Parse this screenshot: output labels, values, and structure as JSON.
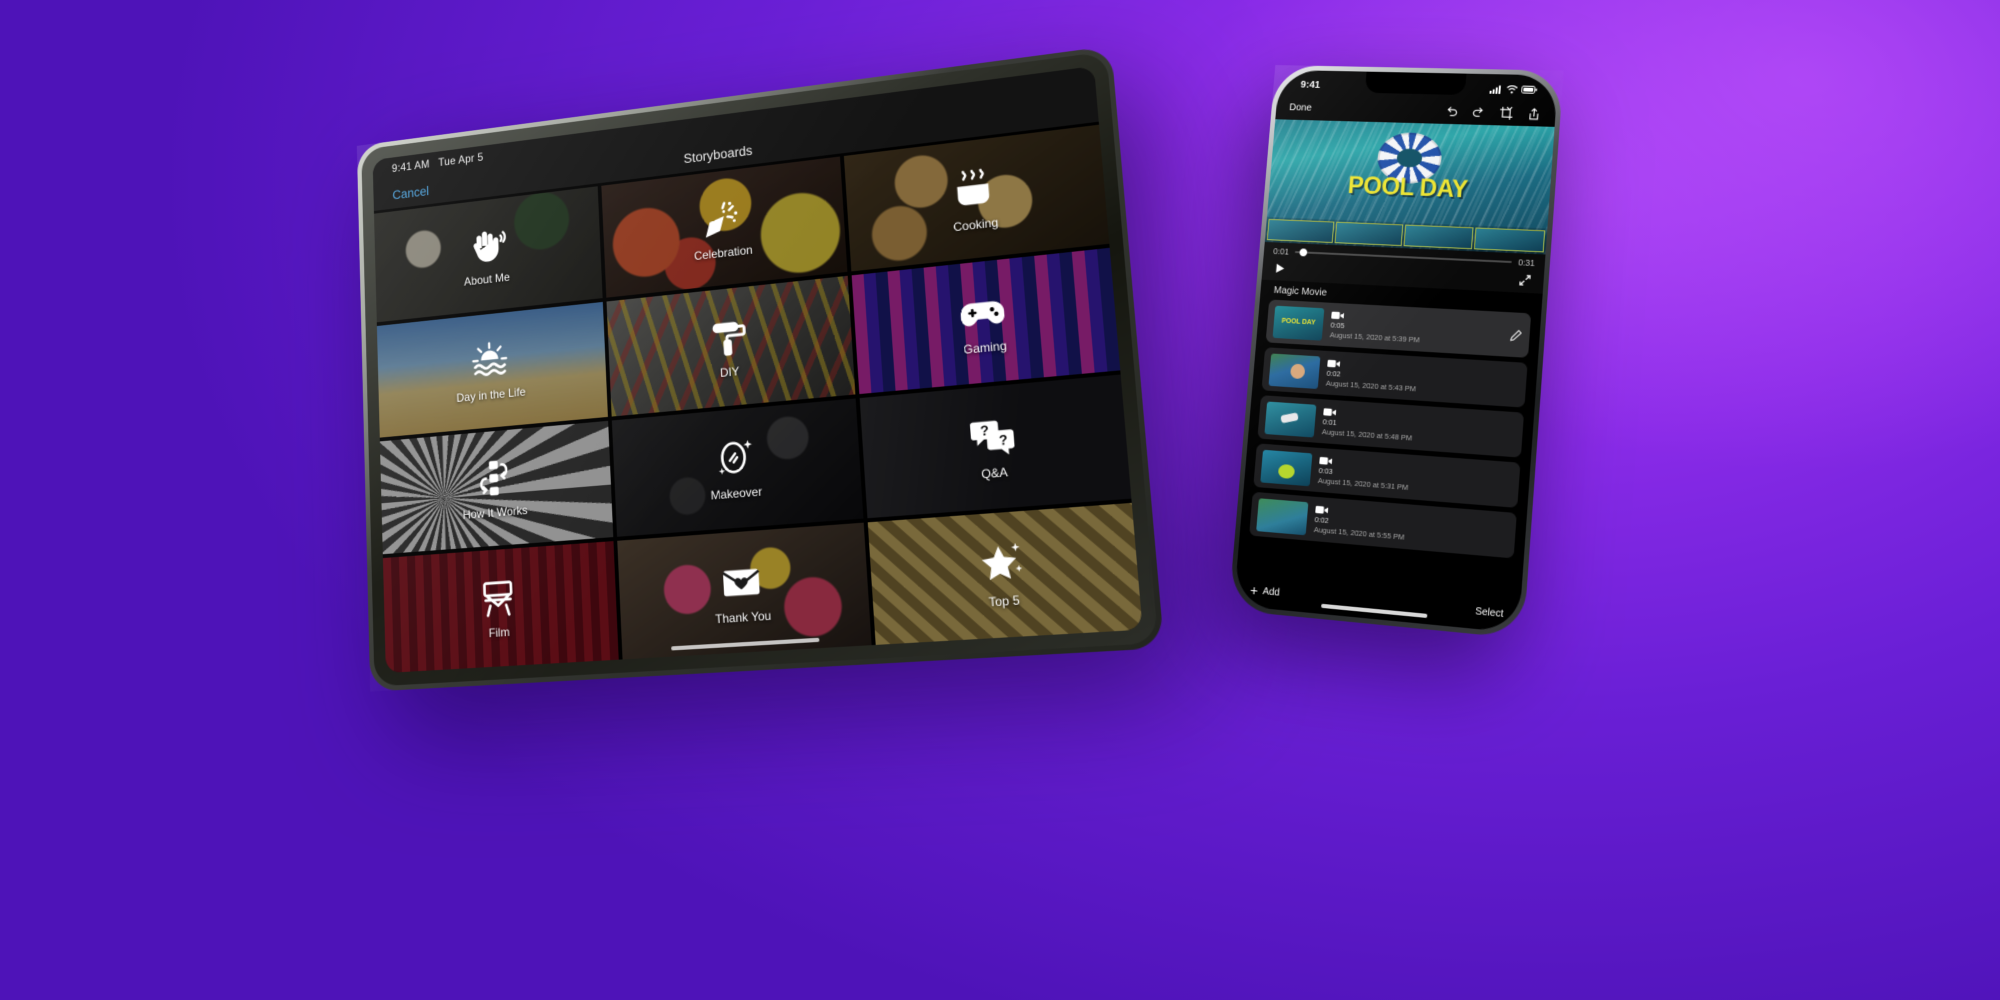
{
  "background": {
    "accent_purple": "#8a2be8",
    "deep_purple": "#4e13b8"
  },
  "ipad": {
    "status": {
      "time": "9:41 AM",
      "date": "Tue Apr 5"
    },
    "nav": {
      "cancel_label": "Cancel",
      "title": "Storyboards"
    },
    "tiles": [
      {
        "label": "About Me",
        "icon": "waving-hands-icon",
        "bg": "bg-aboutme"
      },
      {
        "label": "Celebration",
        "icon": "party-popper-icon",
        "bg": "bg-celebration"
      },
      {
        "label": "Cooking",
        "icon": "steaming-pot-icon",
        "bg": "bg-cooking"
      },
      {
        "label": "Day in the Life",
        "icon": "sunrise-water-icon",
        "bg": "bg-dayinlife"
      },
      {
        "label": "DIY",
        "icon": "paint-roller-icon",
        "bg": "bg-diy"
      },
      {
        "label": "Gaming",
        "icon": "game-controller-icon",
        "bg": "bg-gaming"
      },
      {
        "label": "How It Works",
        "icon": "flow-steps-icon",
        "bg": "bg-howitworks"
      },
      {
        "label": "Makeover",
        "icon": "mirror-sparkle-icon",
        "bg": "bg-makeover"
      },
      {
        "label": "Q&A",
        "icon": "speech-bubbles-icon",
        "bg": "bg-qa"
      },
      {
        "label": "Film",
        "icon": "directors-chair-icon",
        "bg": "bg-film"
      },
      {
        "label": "Thank You",
        "icon": "heart-envelope-icon",
        "bg": "bg-thankyou"
      },
      {
        "label": "Top 5",
        "icon": "star-sparkle-icon",
        "bg": "bg-top5"
      }
    ]
  },
  "iphone": {
    "status": {
      "time": "9:41",
      "signal": "cellular-icon",
      "wifi": "wifi-icon",
      "battery": "battery-icon"
    },
    "toolbar": {
      "done_label": "Done",
      "icons": [
        "undo-icon",
        "redo-icon",
        "crop-icon",
        "share-icon"
      ]
    },
    "preview": {
      "video_title": "POOL DAY"
    },
    "scrubber": {
      "current_time": "0:01",
      "total_time": "0:31",
      "progress_percent": 4
    },
    "transport": {
      "play": "play-icon",
      "fullscreen": "expand-icon"
    },
    "section_title": "Magic Movie",
    "clips": [
      {
        "duration": "0:05",
        "date": "August 15, 2020 at 5:39 PM",
        "selected": true,
        "thumb": "th1"
      },
      {
        "duration": "0:02",
        "date": "August 15, 2020 at 5:43 PM",
        "selected": false,
        "thumb": "th2"
      },
      {
        "duration": "0:01",
        "date": "August 15, 2020 at 5:48 PM",
        "selected": false,
        "thumb": "th3"
      },
      {
        "duration": "0:03",
        "date": "August 15, 2020 at 5:31 PM",
        "selected": false,
        "thumb": "th4"
      },
      {
        "duration": "0:02",
        "date": "August 15, 2020 at 5:55 PM",
        "selected": false,
        "thumb": "th5"
      }
    ],
    "bottom": {
      "add_label": "Add",
      "select_label": "Select"
    }
  }
}
